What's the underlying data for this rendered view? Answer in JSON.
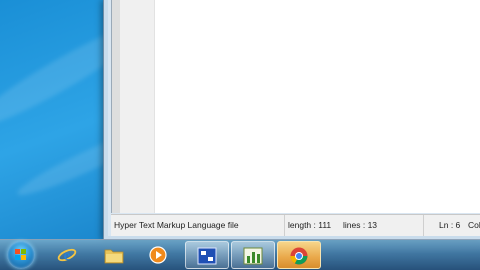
{
  "status_bar": {
    "file_type": "Hyper Text Markup Language file",
    "length": "length : 111",
    "lines": "lines : 13",
    "ln": "Ln : 6",
    "col": "Col"
  },
  "taskbar": {
    "items": [
      {
        "icon": "start-orb-icon"
      },
      {
        "icon": "internet-explorer-icon"
      },
      {
        "icon": "folder-icon"
      },
      {
        "icon": "media-player-icon"
      },
      {
        "icon": "remote-desktop-icon"
      },
      {
        "icon": "chart-editor-icon"
      },
      {
        "icon": "chrome-icon"
      }
    ]
  },
  "colors": {
    "desktop": "#1a8fd6",
    "status_bar": "#f0f0f0",
    "taskbar_highlight": "#e9a84a"
  }
}
